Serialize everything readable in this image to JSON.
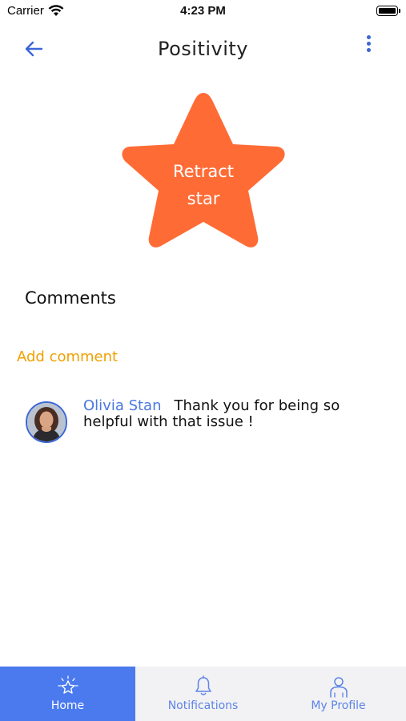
{
  "status_bar": {
    "carrier": "Carrier",
    "time": "4:23 PM"
  },
  "header": {
    "title": "Positivity",
    "back_icon": "arrow-left-icon",
    "menu_icon": "more-vertical-icon"
  },
  "star": {
    "label_line1": "Retract",
    "label_line2": "star",
    "color": "#ff6b35"
  },
  "comments": {
    "heading": "Comments",
    "add_label": "Add comment",
    "items": [
      {
        "author": "Olivia Stan",
        "text": "Thank you for being so helpful with that issue !"
      }
    ]
  },
  "tab_bar": {
    "active_color": "#4a7aee",
    "tabs": [
      {
        "label": "Home",
        "icon": "home-star-icon",
        "active": true
      },
      {
        "label": "Notifications",
        "icon": "bell-icon",
        "active": false
      },
      {
        "label": "My Profile",
        "icon": "user-icon",
        "active": false
      }
    ]
  },
  "colors": {
    "accent_blue": "#3b66d6",
    "link_orange": "#f0a000"
  }
}
